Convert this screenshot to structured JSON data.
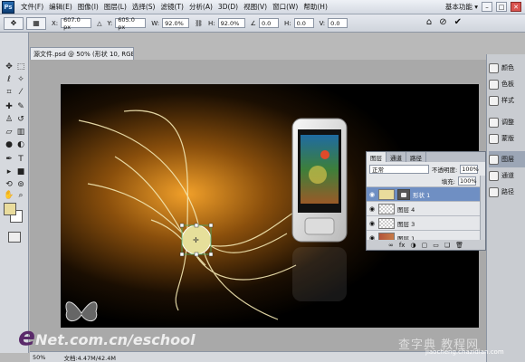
{
  "menubar": {
    "logo": "Ps",
    "items": [
      "文件(F)",
      "编辑(E)",
      "图像(I)",
      "图层(L)",
      "选择(S)",
      "滤镜(T)",
      "分析(A)",
      "3D(D)",
      "视图(V)",
      "窗口(W)",
      "帮助(H)"
    ],
    "zoom": "66% ▾",
    "workspace": "基本功能 ▾",
    "window_buttons": [
      "–",
      "□",
      "✕"
    ]
  },
  "options": {
    "x_label": "X:",
    "x_value": "607.0 px",
    "y_label": "Y:",
    "y_value": "605.0 px",
    "w_label": "W:",
    "w_value": "92.0%",
    "h_label": "H:",
    "h_value": "92.0%",
    "angle_value": "0.0",
    "hskew_label": "H:",
    "hskew_value": "0.0",
    "vskew_label": "V:",
    "vskew_value": "0.0"
  },
  "document": {
    "tab_title": "源文件.psd @ 50% (形状 10, RGB/8) *",
    "tab_close": "×"
  },
  "status": {
    "zoom": "50%",
    "doc_size": "文档:4.47M/42.4M"
  },
  "dock": {
    "items": [
      "颜色",
      "色板",
      "样式",
      "调整",
      "蒙版",
      "图层",
      "通道",
      "路径"
    ]
  },
  "layers_panel": {
    "tabs": [
      "图层",
      "通道",
      "路径"
    ],
    "blend_mode": "正常",
    "opacity_label": "不透明度:",
    "opacity_value": "100%",
    "fill_label": "填充:",
    "fill_value": "100%",
    "layers": [
      {
        "name": "形状 1",
        "selected": true
      },
      {
        "name": "图层 4",
        "selected": false
      },
      {
        "name": "图层 3",
        "selected": false
      },
      {
        "name": "图层 1",
        "selected": false
      }
    ],
    "footer_icons": [
      "∞",
      "fx",
      "◑",
      "▢",
      "▭",
      "❏",
      "🗑"
    ]
  },
  "watermarks": {
    "enet_e": "e",
    "enet_rest": "Net.com.cn/eschool",
    "site_cn": "查字典 教程网",
    "site_url": "jiaocheng.chazidian.com"
  },
  "colors": {
    "foreground": "#e9dc9c",
    "background": "#ffffff",
    "accent": "#6f8fc3"
  }
}
